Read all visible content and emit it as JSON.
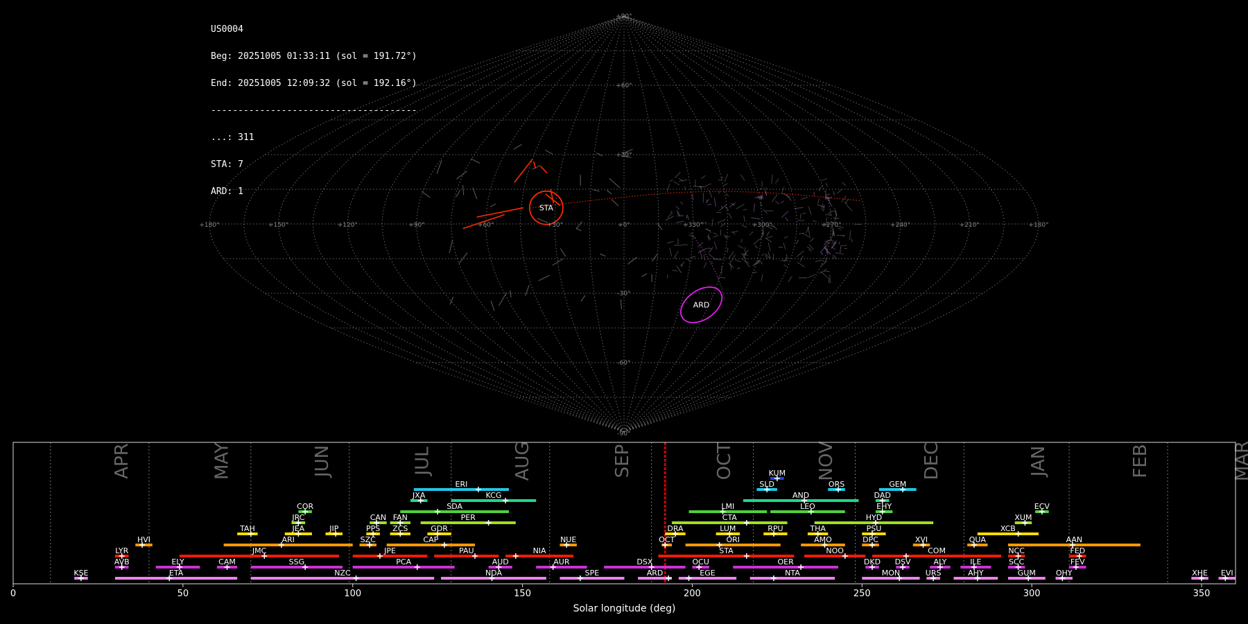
{
  "header": {
    "station": "US0004",
    "begin": "Beg: 20251005 01:33:11 (sol = 191.72°)",
    "end": "End: 20251005 12:09:32 (sol = 192.16°)",
    "separator": "--------------------------------------",
    "counts": [
      "...: 311",
      "STA: 7",
      "ARD: 1"
    ]
  },
  "sky_map": {
    "lon_labels": [
      "+180°",
      "+150°",
      "+120°",
      "+90°",
      "+60°",
      "+30°",
      "+0°",
      "+330°",
      "+300°",
      "+270°",
      "+240°",
      "+210°",
      "+180°"
    ],
    "lat_labels": [
      "+90°",
      "+60°",
      "+30°",
      "-30°",
      "-60°",
      "-90°"
    ],
    "radiants": [
      {
        "name": "STA",
        "lon": 34,
        "lat": 7,
        "color": "#ff2a00"
      },
      {
        "name": "ARD",
        "lon": 319,
        "lat": -35,
        "color": "#e020e8"
      }
    ]
  },
  "chart_data": {
    "type": "bar",
    "xlabel": "Solar longitude (deg)",
    "xlim": [
      0,
      360
    ],
    "xticks": [
      0,
      50,
      100,
      150,
      200,
      250,
      300,
      350
    ],
    "current_sol": 192,
    "months": [
      {
        "label": "APR",
        "start": 11,
        "end": 40
      },
      {
        "label": "MAY",
        "start": 40,
        "end": 70
      },
      {
        "label": "JUN",
        "start": 70,
        "end": 99
      },
      {
        "label": "JUL",
        "start": 99,
        "end": 129
      },
      {
        "label": "AUG",
        "start": 129,
        "end": 158
      },
      {
        "label": "SEP",
        "start": 158,
        "end": 188
      },
      {
        "label": "OCT",
        "start": 188,
        "end": 218
      },
      {
        "label": "NOV",
        "start": 218,
        "end": 248
      },
      {
        "label": "DEC",
        "start": 248,
        "end": 280
      },
      {
        "label": "JAN",
        "start": 280,
        "end": 311
      },
      {
        "label": "FEB",
        "start": 311,
        "end": 340
      },
      {
        "label": "MAR",
        "start": 340,
        "end": 371
      }
    ],
    "showers": [
      {
        "code": "KSE",
        "start": 18,
        "end": 22,
        "peak": 20,
        "row": 0,
        "color": "#ee82ee"
      },
      {
        "code": "ETA",
        "start": 30,
        "end": 66,
        "peak": 46,
        "row": 0,
        "color": "#ee82ee"
      },
      {
        "code": "NZC",
        "start": 70,
        "end": 124,
        "peak": 101,
        "row": 0,
        "color": "#ee82ee"
      },
      {
        "code": "NDA",
        "start": 126,
        "end": 157,
        "peak": 141,
        "row": 0,
        "color": "#ee82ee"
      },
      {
        "code": "SPE",
        "start": 161,
        "end": 180,
        "peak": 167,
        "row": 0,
        "color": "#ee82ee"
      },
      {
        "code": "ARD",
        "start": 184,
        "end": 194,
        "peak": 193,
        "row": 0,
        "color": "#ee82ee"
      },
      {
        "code": "EGE",
        "start": 196,
        "end": 213,
        "peak": 199,
        "row": 0,
        "color": "#ee82ee"
      },
      {
        "code": "NTA",
        "start": 217,
        "end": 242,
        "peak": 224,
        "row": 0,
        "color": "#ee82ee"
      },
      {
        "code": "MON",
        "start": 250,
        "end": 267,
        "peak": 261,
        "row": 0,
        "color": "#ee82ee"
      },
      {
        "code": "URS",
        "start": 269,
        "end": 273,
        "peak": 271,
        "row": 0,
        "color": "#ee82ee"
      },
      {
        "code": "AHY",
        "start": 277,
        "end": 290,
        "peak": 284,
        "row": 0,
        "color": "#ee82ee"
      },
      {
        "code": "GUM",
        "start": 293,
        "end": 304,
        "peak": 299,
        "row": 0,
        "color": "#ee82ee"
      },
      {
        "code": "OHY",
        "start": 307,
        "end": 312,
        "peak": 309,
        "row": 0,
        "color": "#ee82ee"
      },
      {
        "code": "XHE",
        "start": 347,
        "end": 352,
        "peak": 350,
        "row": 0,
        "color": "#ee82ee"
      },
      {
        "code": "EVI",
        "start": 355,
        "end": 360,
        "peak": 357,
        "row": 0,
        "color": "#ee82ee"
      },
      {
        "code": "AVB",
        "start": 30,
        "end": 34,
        "peak": 32,
        "row": 1,
        "color": "#c832d2"
      },
      {
        "code": "ELY",
        "start": 42,
        "end": 55,
        "peak": 49,
        "row": 1,
        "color": "#c832d2"
      },
      {
        "code": "CAM",
        "start": 60,
        "end": 66,
        "peak": 63,
        "row": 1,
        "color": "#c832d2"
      },
      {
        "code": "SSG",
        "start": 70,
        "end": 97,
        "peak": 86,
        "row": 1,
        "color": "#c832d2"
      },
      {
        "code": "PCA",
        "start": 100,
        "end": 130,
        "peak": 119,
        "row": 1,
        "color": "#c832d2"
      },
      {
        "code": "AUD",
        "start": 140,
        "end": 147,
        "peak": 143,
        "row": 1,
        "color": "#c832d2"
      },
      {
        "code": "AUR",
        "start": 154,
        "end": 169,
        "peak": 159,
        "row": 1,
        "color": "#c832d2"
      },
      {
        "code": "DSX",
        "start": 174,
        "end": 198,
        "peak": 188,
        "row": 1,
        "color": "#c832d2"
      },
      {
        "code": "OCU",
        "start": 200,
        "end": 205,
        "peak": 202,
        "row": 1,
        "color": "#c832d2"
      },
      {
        "code": "OER",
        "start": 212,
        "end": 243,
        "peak": 232,
        "row": 1,
        "color": "#c832d2"
      },
      {
        "code": "DKD",
        "start": 251,
        "end": 255,
        "peak": 253,
        "row": 1,
        "color": "#c832d2"
      },
      {
        "code": "DSV",
        "start": 260,
        "end": 264,
        "peak": 262,
        "row": 1,
        "color": "#c832d2"
      },
      {
        "code": "ALY",
        "start": 270,
        "end": 276,
        "peak": 273,
        "row": 1,
        "color": "#c832d2"
      },
      {
        "code": "ILE",
        "start": 279,
        "end": 288,
        "peak": 283,
        "row": 1,
        "color": "#c832d2"
      },
      {
        "code": "SCC",
        "start": 293,
        "end": 298,
        "peak": 296,
        "row": 1,
        "color": "#c832d2"
      },
      {
        "code": "FEV",
        "start": 311,
        "end": 316,
        "peak": 313,
        "row": 1,
        "color": "#c832d2"
      },
      {
        "code": "LYR",
        "start": 30,
        "end": 34,
        "peak": 32,
        "row": 2,
        "color": "#ff1a00"
      },
      {
        "code": "JMC",
        "start": 49,
        "end": 96,
        "peak": 74,
        "row": 2,
        "color": "#ff1a00"
      },
      {
        "code": "JPE",
        "start": 100,
        "end": 122,
        "peak": 108,
        "row": 2,
        "color": "#ff1a00"
      },
      {
        "code": "PAU",
        "start": 124,
        "end": 143,
        "peak": 136,
        "row": 2,
        "color": "#ff1a00"
      },
      {
        "code": "NIA",
        "start": 145,
        "end": 165,
        "peak": 148,
        "row": 2,
        "color": "#ff1a00"
      },
      {
        "code": "STA",
        "start": 190,
        "end": 230,
        "peak": 216,
        "row": 2,
        "color": "#ff1a00"
      },
      {
        "code": "NOO",
        "start": 233,
        "end": 251,
        "peak": 245,
        "row": 2,
        "color": "#ff1a00"
      },
      {
        "code": "COM",
        "start": 253,
        "end": 291,
        "peak": 263,
        "row": 2,
        "color": "#ff1a00"
      },
      {
        "code": "NCC",
        "start": 293,
        "end": 298,
        "peak": 296,
        "row": 2,
        "color": "#ff1a00"
      },
      {
        "code": "FED",
        "start": 311,
        "end": 316,
        "peak": 314,
        "row": 2,
        "color": "#ff1a00"
      },
      {
        "code": "HVI",
        "start": 36,
        "end": 41,
        "peak": 38,
        "row": 3,
        "color": "#ff9900"
      },
      {
        "code": "ARI",
        "start": 62,
        "end": 100,
        "peak": 79,
        "row": 3,
        "color": "#ff9900"
      },
      {
        "code": "SZC",
        "start": 102,
        "end": 107,
        "peak": 105,
        "row": 3,
        "color": "#ff9900"
      },
      {
        "code": "CAP",
        "start": 110,
        "end": 136,
        "peak": 127,
        "row": 3,
        "color": "#ff9900"
      },
      {
        "code": "NUE",
        "start": 161,
        "end": 166,
        "peak": 163,
        "row": 3,
        "color": "#ff9900"
      },
      {
        "code": "OCT",
        "start": 191,
        "end": 194,
        "peak": 192,
        "row": 3,
        "color": "#ff9900"
      },
      {
        "code": "ORI",
        "start": 198,
        "end": 226,
        "peak": 208,
        "row": 3,
        "color": "#ff9900"
      },
      {
        "code": "AMO",
        "start": 232,
        "end": 245,
        "peak": 239,
        "row": 3,
        "color": "#ff9900"
      },
      {
        "code": "DPC",
        "start": 250,
        "end": 255,
        "peak": 253,
        "row": 3,
        "color": "#ff9900"
      },
      {
        "code": "XVI",
        "start": 265,
        "end": 270,
        "peak": 268,
        "row": 3,
        "color": "#ff9900"
      },
      {
        "code": "QUA",
        "start": 281,
        "end": 287,
        "peak": 283,
        "row": 3,
        "color": "#ff9900"
      },
      {
        "code": "AAN",
        "start": 293,
        "end": 332,
        "peak": 312,
        "row": 3,
        "color": "#ff9900"
      },
      {
        "code": "TAH",
        "start": 66,
        "end": 72,
        "peak": 70,
        "row": 4,
        "color": "#ffdd00"
      },
      {
        "code": "JEA",
        "start": 80,
        "end": 88,
        "peak": 84,
        "row": 4,
        "color": "#ffdd00"
      },
      {
        "code": "JIP",
        "start": 92,
        "end": 97,
        "peak": 95,
        "row": 4,
        "color": "#ffdd00"
      },
      {
        "code": "PPS",
        "start": 104,
        "end": 108,
        "peak": 106,
        "row": 4,
        "color": "#ffdd00"
      },
      {
        "code": "ZCS",
        "start": 111,
        "end": 117,
        "peak": 114,
        "row": 4,
        "color": "#ffdd00"
      },
      {
        "code": "GDR",
        "start": 122,
        "end": 129,
        "peak": 125,
        "row": 4,
        "color": "#ffdd00"
      },
      {
        "code": "DRA",
        "start": 192,
        "end": 198,
        "peak": 195,
        "row": 4,
        "color": "#ffdd00"
      },
      {
        "code": "LUM",
        "start": 207,
        "end": 214,
        "peak": 211,
        "row": 4,
        "color": "#ffdd00"
      },
      {
        "code": "RPU",
        "start": 221,
        "end": 228,
        "peak": 224,
        "row": 4,
        "color": "#ffdd00"
      },
      {
        "code": "THA",
        "start": 234,
        "end": 240,
        "peak": 237,
        "row": 4,
        "color": "#ffdd00"
      },
      {
        "code": "PSU",
        "start": 250,
        "end": 257,
        "peak": 253,
        "row": 4,
        "color": "#ffdd00"
      },
      {
        "code": "XCB",
        "start": 284,
        "end": 302,
        "peak": 296,
        "row": 4,
        "color": "#ffdd00"
      },
      {
        "code": "JRC",
        "start": 82,
        "end": 86,
        "peak": 84,
        "row": 5,
        "color": "#a0e020"
      },
      {
        "code": "CAN",
        "start": 105,
        "end": 110,
        "peak": 107,
        "row": 5,
        "color": "#a0e020"
      },
      {
        "code": "FAN",
        "start": 111,
        "end": 117,
        "peak": 114,
        "row": 5,
        "color": "#a0e020"
      },
      {
        "code": "PER",
        "start": 120,
        "end": 148,
        "peak": 140,
        "row": 5,
        "color": "#a0e020"
      },
      {
        "code": "CTA",
        "start": 194,
        "end": 228,
        "peak": 216,
        "row": 5,
        "color": "#a0e020"
      },
      {
        "code": "HYD",
        "start": 236,
        "end": 271,
        "peak": 254,
        "row": 5,
        "color": "#a0e020"
      },
      {
        "code": "XUM",
        "start": 295,
        "end": 300,
        "peak": 298,
        "row": 5,
        "color": "#a0e020"
      },
      {
        "code": "COR",
        "start": 84,
        "end": 88,
        "peak": 86,
        "row": 6,
        "color": "#50d040"
      },
      {
        "code": "SDA",
        "start": 114,
        "end": 146,
        "peak": 125,
        "row": 6,
        "color": "#50d040"
      },
      {
        "code": "LMI",
        "start": 199,
        "end": 222,
        "peak": 209,
        "row": 6,
        "color": "#50d040"
      },
      {
        "code": "LEO",
        "start": 223,
        "end": 245,
        "peak": 235,
        "row": 6,
        "color": "#50d040"
      },
      {
        "code": "EHY",
        "start": 254,
        "end": 259,
        "peak": 256,
        "row": 6,
        "color": "#50d040"
      },
      {
        "code": "ECV",
        "start": 301,
        "end": 305,
        "peak": 303,
        "row": 6,
        "color": "#50d040"
      },
      {
        "code": "JXA",
        "start": 117,
        "end": 122,
        "peak": 120,
        "row": 7,
        "color": "#20d888"
      },
      {
        "code": "KCG",
        "start": 129,
        "end": 154,
        "peak": 145,
        "row": 7,
        "color": "#20d888"
      },
      {
        "code": "AND",
        "start": 215,
        "end": 249,
        "peak": 233,
        "row": 7,
        "color": "#20d888"
      },
      {
        "code": "DAD",
        "start": 254,
        "end": 258,
        "peak": 256,
        "row": 7,
        "color": "#20d888"
      },
      {
        "code": "ERI",
        "start": 118,
        "end": 146,
        "peak": 137,
        "row": 8,
        "color": "#20c8e8"
      },
      {
        "code": "SLD",
        "start": 219,
        "end": 225,
        "peak": 222,
        "row": 8,
        "color": "#20c8e8"
      },
      {
        "code": "ORS",
        "start": 240,
        "end": 245,
        "peak": 243,
        "row": 8,
        "color": "#20c8e8"
      },
      {
        "code": "GEM",
        "start": 255,
        "end": 266,
        "peak": 262,
        "row": 8,
        "color": "#20c8e8"
      },
      {
        "code": "KUM",
        "start": 223,
        "end": 227,
        "peak": 225,
        "row": 9,
        "color": "#2040ff"
      }
    ]
  }
}
